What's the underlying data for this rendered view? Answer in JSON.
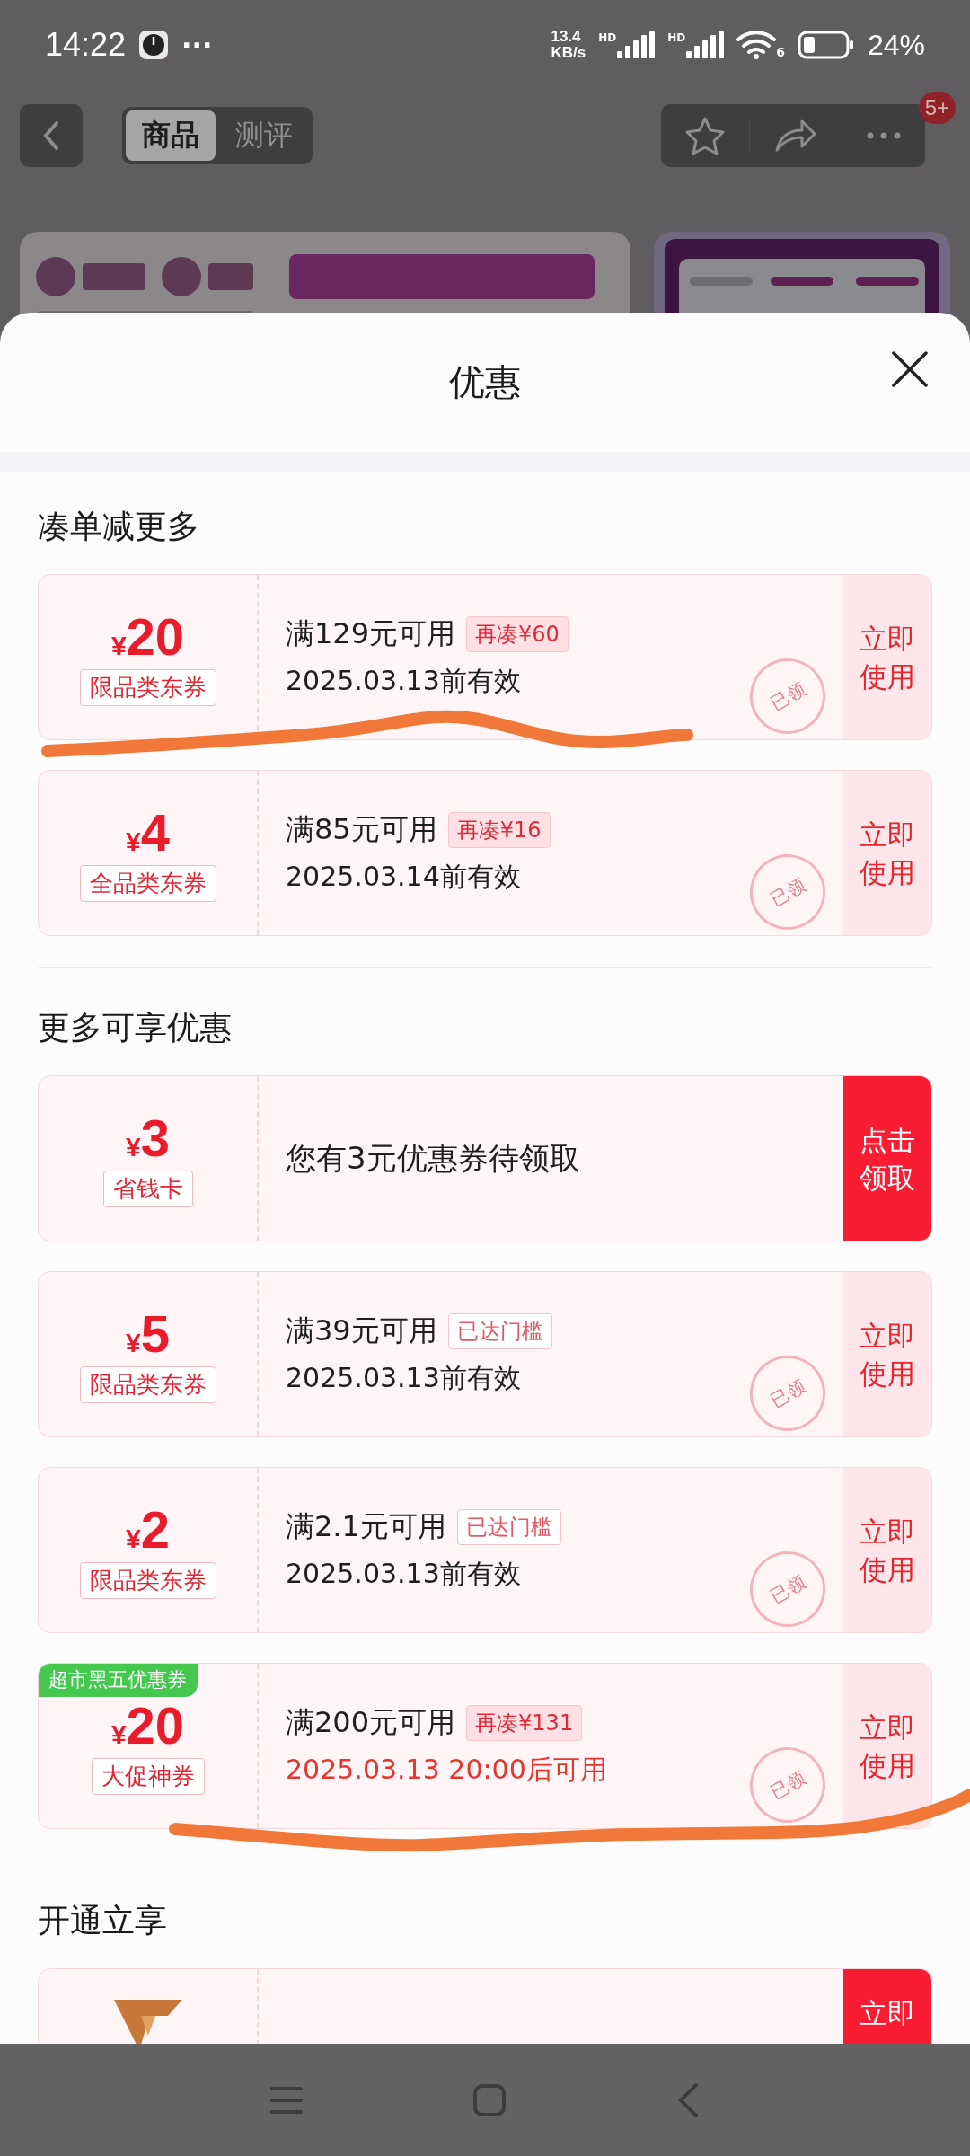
{
  "status_bar": {
    "time": "14:22",
    "more": "···",
    "speed": [
      "13.4",
      "KB/s"
    ],
    "signal_labels": [
      "HD",
      "HD"
    ],
    "wifi_label": "6",
    "battery": "24%"
  },
  "header": {
    "tabs": [
      {
        "label": "商品",
        "selected": true
      },
      {
        "label": "测评",
        "selected": false
      }
    ],
    "badge": "5+"
  },
  "sheet": {
    "title": "优惠"
  },
  "sections": [
    {
      "title": "凑单减更多",
      "coupons": [
        {
          "kind": "threshold",
          "symbol": "¥",
          "amount": "20",
          "tag": "限品类东券",
          "condition": "满129元可用",
          "hint": "再凑¥60",
          "threshold_met": false,
          "validity": "2025.03.13前有效",
          "validity_highlight": false,
          "stamp": "已领",
          "action": "立即使用",
          "action_primary": false
        },
        {
          "kind": "threshold",
          "symbol": "¥",
          "amount": "4",
          "tag": "全品类东券",
          "condition": "满85元可用",
          "hint": "再凑¥16",
          "threshold_met": false,
          "validity": "2025.03.14前有效",
          "validity_highlight": false,
          "stamp": "已领",
          "action": "立即使用",
          "action_primary": false
        }
      ]
    },
    {
      "title": "更多可享优惠",
      "coupons": [
        {
          "kind": "claim",
          "symbol": "¥",
          "amount": "3",
          "tag": "省钱卡",
          "condition": "您有3元优惠券待领取",
          "action": "点击领取",
          "action_primary": true
        },
        {
          "kind": "threshold",
          "symbol": "¥",
          "amount": "5",
          "tag": "限品类东券",
          "condition": "满39元可用",
          "hint": "已达门槛",
          "threshold_met": true,
          "validity": "2025.03.13前有效",
          "validity_highlight": false,
          "stamp": "已领",
          "action": "立即使用",
          "action_primary": false
        },
        {
          "kind": "threshold",
          "symbol": "¥",
          "amount": "2",
          "tag": "限品类东券",
          "condition": "满2.1元可用",
          "hint": "已达门槛",
          "threshold_met": true,
          "validity": "2025.03.13前有效",
          "validity_highlight": false,
          "stamp": "已领",
          "action": "立即使用",
          "action_primary": false
        },
        {
          "kind": "threshold",
          "ribbon": "超市黑五优惠券",
          "symbol": "¥",
          "amount": "20",
          "tag": "大促神券",
          "condition": "满200元可用",
          "hint": "再凑¥131",
          "threshold_met": false,
          "validity": "2025.03.13 20:00后可用",
          "validity_highlight": true,
          "stamp": "已领",
          "action": "立即使用",
          "action_primary": false
        }
      ]
    },
    {
      "title": "开通立享",
      "coupons": [
        {
          "kind": "member",
          "action": "立即",
          "action_primary": true
        }
      ]
    }
  ]
}
